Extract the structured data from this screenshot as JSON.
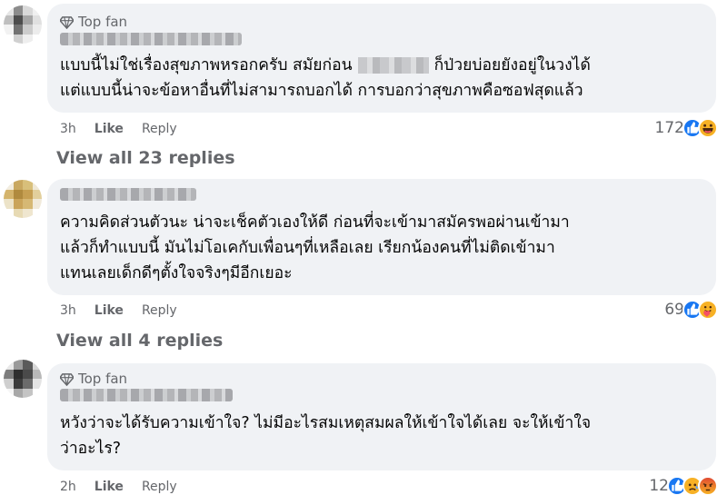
{
  "comments": [
    {
      "badge": "Top fan",
      "lines": [
        "แบบนี้ไม่ใช่เรื่องสุขภาพหรอกครับ สมัยก่อน",
        "ก็ป่วยบ่อยยังอยู่ในวงได้",
        "แต่แบบนี้น่าจะข้อหาอื่นที่ไม่สามารถบอกได้ การบอกว่าสุขภาพคือซอฟสุดแล้ว"
      ],
      "time": "3h",
      "like": "Like",
      "reply": "Reply",
      "reaction_count": "172",
      "reaction_icons": [
        "like-icon",
        "haha-icon"
      ],
      "view_replies": "View all 23 replies"
    },
    {
      "badge": "",
      "lines": [
        "ความคิดส่วนตัวนะ น่าจะเช็คตัวเองให้ดี ก่อนที่จะเข้ามาสมัครพอผ่านเข้ามา",
        "แล้วก็ทำแบบนี้ มันไม่โอเคกับเพื่อนๆที่เหลือเลย เรียกน้องคนที่ไม่ติดเข้ามา",
        "แทนเลยเด็กดีๆตั้งใจจริงๆมีอีกเยอะ"
      ],
      "time": "3h",
      "like": "Like",
      "reply": "Reply",
      "reaction_count": "69",
      "reaction_icons": [
        "like-icon",
        "care-icon"
      ],
      "view_replies": "View all 4 replies"
    },
    {
      "badge": "Top fan",
      "lines": [
        "หวังว่าจะได้รับความเข้าใจ? ไม่มีอะไรสมเหตุสมผลให้เข้าใจได้เลย จะให้เข้าใจ",
        "ว่าอะไร?"
      ],
      "time": "2h",
      "like": "Like",
      "reply": "Reply",
      "reaction_count": "12",
      "reaction_icons": [
        "like-icon",
        "sad-icon",
        "angry-icon"
      ]
    }
  ],
  "colors": {
    "bubble": "#f0f2f5",
    "secondary_text": "#65676b",
    "like_blue": "#1877f2",
    "emoji_yellow": "#f7b125",
    "angry_red": "#e9710f"
  }
}
